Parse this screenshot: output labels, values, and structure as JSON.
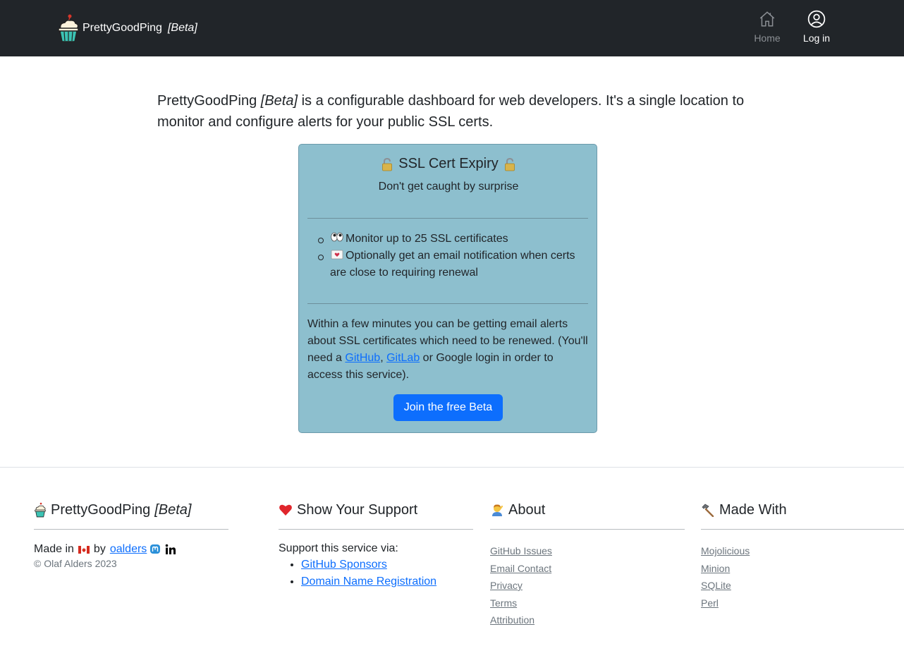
{
  "navbar": {
    "brand_name": "PrettyGoodPing",
    "brand_beta": "[Beta]",
    "home_label": "Home",
    "login_label": "Log in"
  },
  "intro": {
    "brand": "PrettyGoodPing",
    "beta": "[Beta]",
    "text": " is a configurable dashboard for web developers. It's a single location to monitor and configure alerts for your public SSL certs."
  },
  "card": {
    "title": "SSL Cert Expiry",
    "subtitle": "Don't get caught by surprise",
    "features": [
      "Monitor up to 25 SSL certificates",
      "Optionally get an email notification when certs are close to requiring renewal"
    ],
    "body_start": "Within a few minutes you can be getting email alerts about SSL certificates which need to be renewed. (You'll need a ",
    "github_link": "GitHub",
    "comma": ", ",
    "gitlab_link": "GitLab",
    "body_end": " or Google login in order to access this service).",
    "button_label": "Join the free Beta"
  },
  "footer": {
    "col1": {
      "title": "PrettyGoodPing",
      "beta": "[Beta]",
      "made_in": "Made in",
      "by": "by",
      "author_link": "oalders",
      "copyright": "© Olaf Alders 2023"
    },
    "col2": {
      "title": "Show Your Support",
      "text": "Support this service via:",
      "links": [
        "GitHub Sponsors",
        "Domain Name Registration"
      ]
    },
    "col3": {
      "title": "About",
      "links": [
        "GitHub Issues",
        "Email Contact",
        "Privacy",
        "Terms",
        "Attribution"
      ]
    },
    "col4": {
      "title": "Made With",
      "links": [
        "Mojolicious",
        "Minion",
        "SQLite",
        "Perl"
      ]
    }
  },
  "colors": {
    "navbar_bg": "#212529",
    "card_bg": "#8dbfce",
    "primary": "#0d6efd"
  },
  "icons": [
    "cupcake-icon",
    "home-icon",
    "user-circle-icon",
    "lock-icon",
    "eyes-icon",
    "envelope-icon",
    "heart-icon",
    "person-icon",
    "hammer-icon",
    "canada-flag-icon",
    "mastodon-icon",
    "linkedin-icon"
  ]
}
